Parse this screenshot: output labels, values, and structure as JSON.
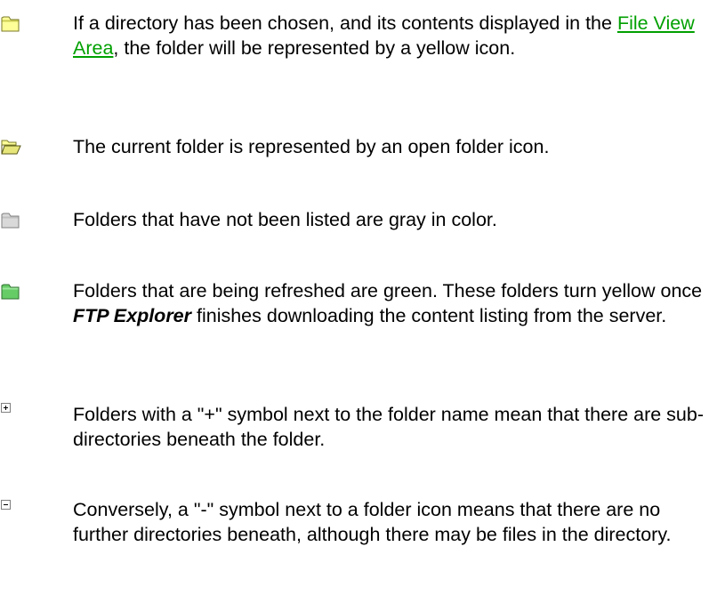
{
  "entries": [
    {
      "icon": "closed-yellow-folder-icon",
      "before_link": "If a directory has been chosen, and its contents displayed in the ",
      "link": "File View Area",
      "after_link": ", the folder will be represented by a yellow icon."
    },
    {
      "icon": "open-folder-icon",
      "text": "The current folder is represented by an open folder icon."
    },
    {
      "icon": "gray-folder-icon",
      "text": "Folders that have not been listed are gray in color."
    },
    {
      "icon": "green-folder-icon",
      "before_em": "Folders that are being refreshed are green. These folders turn yellow once ",
      "em": "FTP Explorer",
      "after_em": " finishes downloading the content listing from the server."
    },
    {
      "icon": "plus-box-icon",
      "text": "Folders with a \"+\" symbol next to the folder name mean that there are sub-directories beneath the folder."
    },
    {
      "icon": "minus-box-icon",
      "text": "Conversely, a \"-\" symbol next to a folder icon means that there are no further directories beneath, although there may be files in the directory."
    }
  ],
  "colors": {
    "link": "#00a000",
    "folder_yellow": "#ffff99",
    "folder_gray": "#d9d9d9",
    "folder_green": "#66cc66"
  }
}
